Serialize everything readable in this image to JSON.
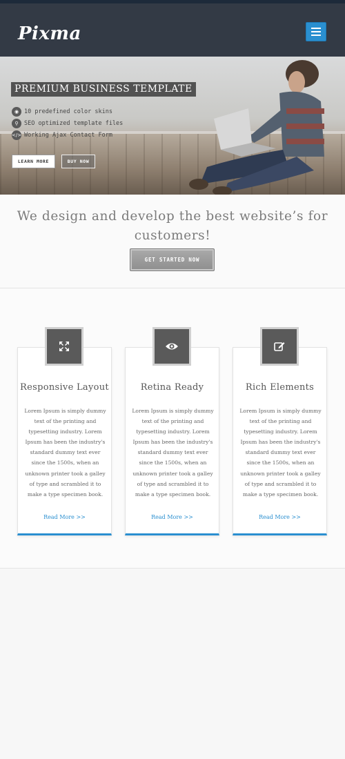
{
  "header": {
    "logo": "Pixma",
    "dropdown_icon": "chevron-down-icon",
    "menu_icon": "hamburger-menu-icon",
    "accent": "#2a8fd0",
    "background": "#333a45"
  },
  "hero": {
    "title": "PREMIUM BUSINESS TEMPLATE",
    "features": [
      {
        "icon": "camera-icon",
        "text": "10 predefined color skins"
      },
      {
        "icon": "search-icon",
        "text": "SEO optimized template files"
      },
      {
        "icon": "code-icon",
        "text": "Working Ajax Contact Form"
      }
    ],
    "learn_more": "LEARN MORE",
    "buy_now": "BUY NOW"
  },
  "cta": {
    "heading": "We design and develop the best website’s for customers!",
    "button": "GET STARTED NOW"
  },
  "services": [
    {
      "icon": "expand-arrows-icon",
      "title": "Responsive Layout",
      "body": "Lorem Ipsum is simply dummy text of the printing and typesetting industry. Lorem Ipsum has been the industry's standard dummy text ever since the 1500s, when an unknown printer took a galley of type and scrambled it to make a type specimen book.",
      "link": "Read More >>"
    },
    {
      "icon": "eye-icon",
      "title": "Retina Ready",
      "body": "Lorem Ipsum is simply dummy text of the printing and typesetting industry. Lorem Ipsum has been the industry's standard dummy text ever since the 1500s, when an unknown printer took a galley of type and scrambled it to make a type specimen book.",
      "link": "Read More >>"
    },
    {
      "icon": "edit-icon",
      "title": "Rich Elements",
      "body": "Lorem Ipsum is simply dummy text of the printing and typesetting industry. Lorem Ipsum has been the industry's standard dummy text ever since the 1500s, when an unknown printer took a galley of type and scrambled it to make a type specimen book.",
      "link": "Read More >>"
    }
  ]
}
